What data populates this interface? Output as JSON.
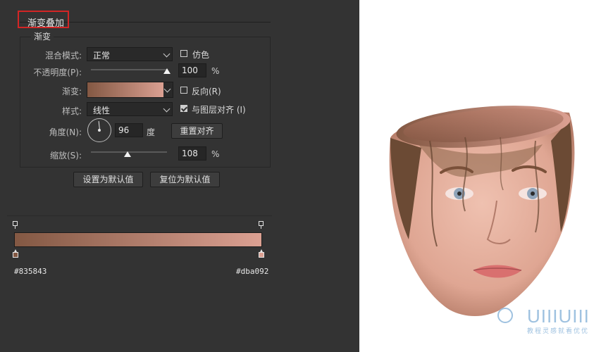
{
  "section_title": "渐变叠加",
  "group_title": "渐变",
  "blend_mode": {
    "label": "混合模式:",
    "value": "正常"
  },
  "dither": {
    "label": "仿色",
    "checked": false
  },
  "opacity": {
    "label": "不透明度(P):",
    "value": "100",
    "unit": "%",
    "level": 1.0
  },
  "gradient": {
    "label": "渐变:",
    "start_color": "#835843",
    "end_color": "#dba092"
  },
  "reverse": {
    "label": "反向(R)",
    "checked": false
  },
  "style": {
    "label": "样式:",
    "value": "线性"
  },
  "align_with_layer": {
    "label": "与图层对齐 (I)",
    "checked": true
  },
  "angle": {
    "label": "角度(N):",
    "value": "96",
    "unit": "度"
  },
  "reset_alignment_button": "重置对齐",
  "scale": {
    "label": "缩放(S):",
    "value": "108",
    "unit": "%",
    "level": 0.48
  },
  "set_default_button": "设置为默认值",
  "reset_default_button": "复位为默认值",
  "gradient_editor": {
    "left_hex": "#835843",
    "right_hex": "#dba092"
  },
  "watermark": {
    "logo": "UIIIUIII",
    "subtitle": "教程灵感就看优优"
  }
}
